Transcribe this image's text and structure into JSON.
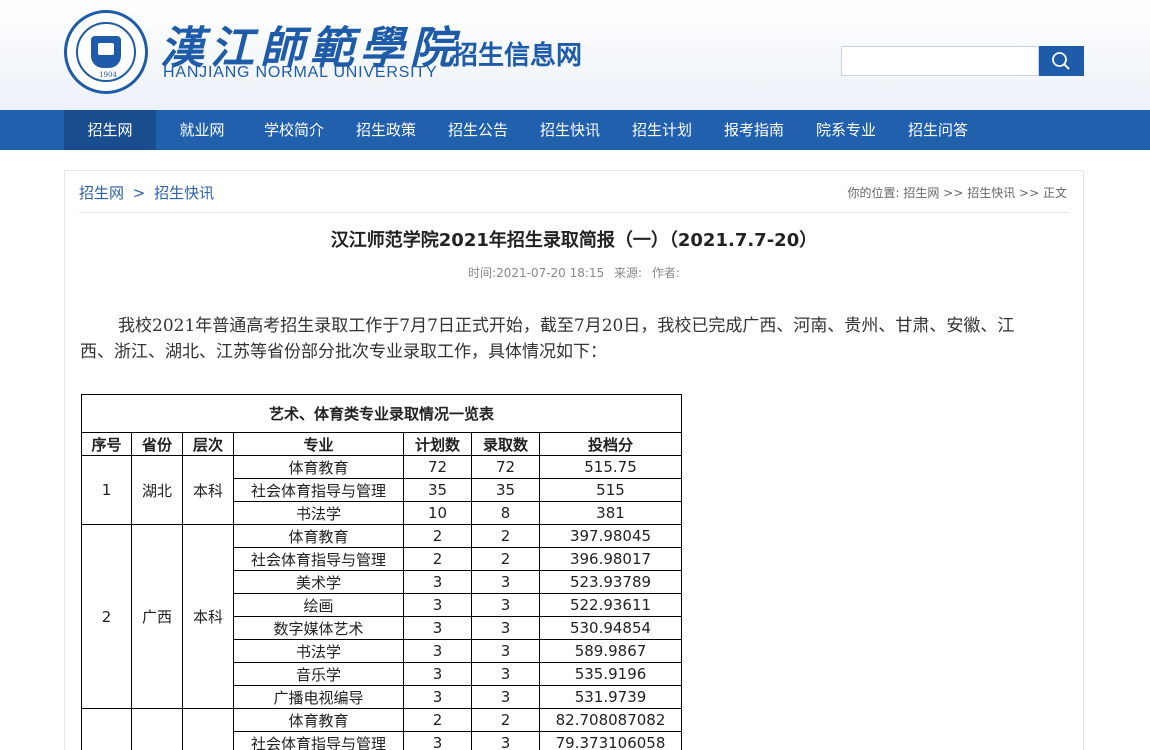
{
  "header": {
    "logo_year": "1904",
    "brand_cn": "漢江師範學院",
    "brand_en": "HANJIANG NORMAL UNIVERSITY",
    "site_name": "招生信息网",
    "search": {
      "placeholder": ""
    }
  },
  "nav": {
    "items": [
      "招生网",
      "就业网",
      "学校简介",
      "招生政策",
      "招生公告",
      "招生快讯",
      "招生计划",
      "报考指南",
      "院系专业",
      "招生问答"
    ],
    "active": "招生网"
  },
  "breadcrumb": {
    "home": "招生网",
    "sep": ">",
    "section": "招生快讯",
    "location_prefix": "你的位置:",
    "location_home": "招生网",
    "location_sep": ">>",
    "location_section": "招生快讯",
    "location_current": "正文"
  },
  "article": {
    "title": "汉江师范学院2021年招生录取简报（一）（2021.7.7-20）",
    "time": "时间:2021-07-20 18:15",
    "source": "来源:",
    "author": "作者:",
    "paragraph": "我校2021年普通高考招生录取工作于7月7日正式开始，截至7月20日，我校已完成广西、河南、贵州、甘肃、安徽、江西、浙江、湖北、江苏等省份部分批次专业录取工作，具体情况如下："
  },
  "table": {
    "caption": "艺术、体育类专业录取情况一览表",
    "headers": [
      "序号",
      "省份",
      "层次",
      "专业",
      "计划数",
      "录取数",
      "投档分"
    ],
    "groups": [
      {
        "no": "1",
        "province": "湖北",
        "level": "本科",
        "rows": [
          {
            "major": "体育教育",
            "plan": "72",
            "admit": "72",
            "score": "515.75"
          },
          {
            "major": "社会体育指导与管理",
            "plan": "35",
            "admit": "35",
            "score": "515"
          },
          {
            "major": "书法学",
            "plan": "10",
            "admit": "8",
            "score": "381"
          }
        ]
      },
      {
        "no": "2",
        "province": "广西",
        "level": "本科",
        "rows": [
          {
            "major": "体育教育",
            "plan": "2",
            "admit": "2",
            "score": "397.98045"
          },
          {
            "major": "社会体育指导与管理",
            "plan": "2",
            "admit": "2",
            "score": "396.98017"
          },
          {
            "major": "美术学",
            "plan": "3",
            "admit": "3",
            "score": "523.93789"
          },
          {
            "major": "绘画",
            "plan": "3",
            "admit": "3",
            "score": "522.93611"
          },
          {
            "major": "数字媒体艺术",
            "plan": "3",
            "admit": "3",
            "score": "530.94854"
          },
          {
            "major": "书法学",
            "plan": "3",
            "admit": "3",
            "score": "589.9867"
          },
          {
            "major": "音乐学",
            "plan": "3",
            "admit": "3",
            "score": "535.9196"
          },
          {
            "major": "广播电视编导",
            "plan": "3",
            "admit": "3",
            "score": "531.9739"
          }
        ]
      },
      {
        "no": "",
        "province": "",
        "level": "",
        "rows": [
          {
            "major": "体育教育",
            "plan": "2",
            "admit": "2",
            "score": "82.708087082"
          },
          {
            "major": "社会体育指导与管理",
            "plan": "3",
            "admit": "3",
            "score": "79.373106058"
          }
        ]
      }
    ]
  },
  "colors": {
    "brand": "#1e5ba8",
    "nav": "#2060ad",
    "nav_active": "#1a4d8e"
  },
  "icons": {
    "search": "search-icon",
    "logo": "university-seal-icon"
  }
}
